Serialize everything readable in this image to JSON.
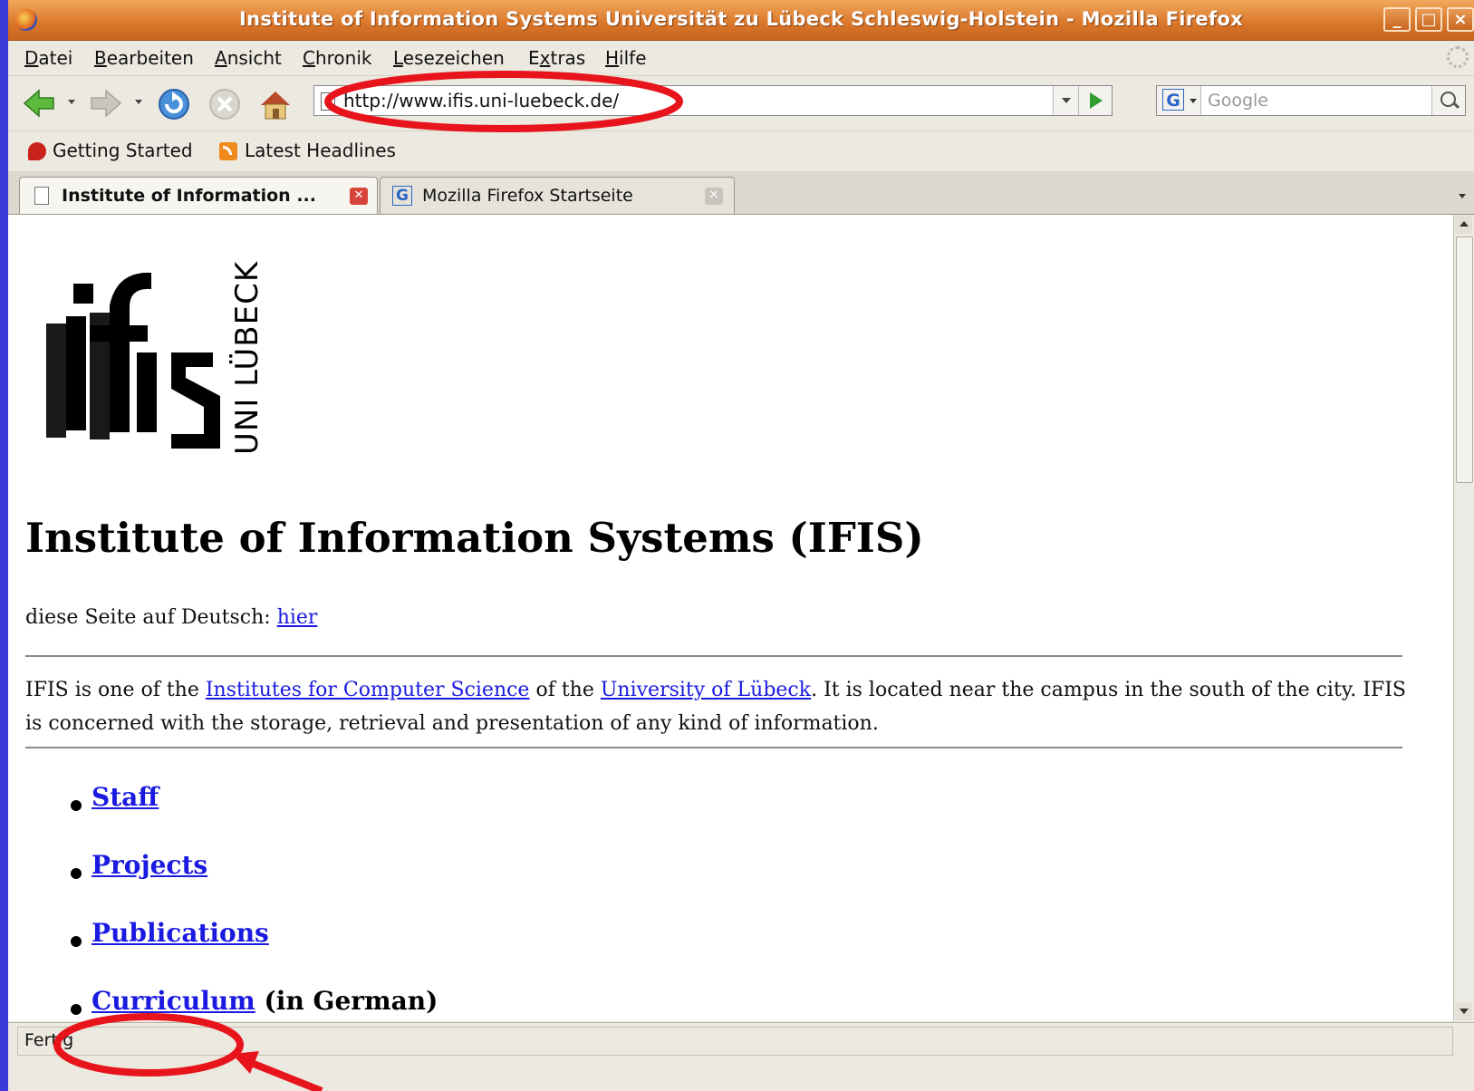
{
  "window": {
    "title": "Institute of Information Systems Universität zu Lübeck Schleswig-Holstein - Mozilla Firefox",
    "controls": {
      "minimize": "_",
      "maximize": "□",
      "close": "×"
    }
  },
  "menubar": {
    "items": [
      {
        "pre": "",
        "ul": "D",
        "post": "atei"
      },
      {
        "pre": "",
        "ul": "B",
        "post": "earbeiten"
      },
      {
        "pre": "",
        "ul": "A",
        "post": "nsicht"
      },
      {
        "pre": "",
        "ul": "C",
        "post": "hronik"
      },
      {
        "pre": "",
        "ul": "L",
        "post": "esezeichen"
      },
      {
        "pre": "E",
        "ul": "x",
        "post": "tras"
      },
      {
        "pre": "",
        "ul": "H",
        "post": "ilfe"
      }
    ]
  },
  "navbar": {
    "url": "http://www.ifis.uni-luebeck.de/",
    "search_engine_letter": "G",
    "search_placeholder": "Google"
  },
  "bookmarks": {
    "items": [
      "Getting Started",
      "Latest Headlines"
    ]
  },
  "tabs": [
    {
      "label": "Institute of Information ...",
      "active": true
    },
    {
      "label": "Mozilla Firefox Startseite",
      "active": false,
      "icon_letter": "G"
    }
  ],
  "page": {
    "logo": {
      "mark": "ifis",
      "vertical_text": "UNI LÜBECK"
    },
    "heading": "Institute of Information Systems (IFIS)",
    "german": {
      "text": "diese Seite auf Deutsch: ",
      "link": "hier"
    },
    "intro": {
      "t1": "IFIS is one of the ",
      "l1": "Institutes for Computer Science",
      "t2": " of the ",
      "l2": "University of Lübeck",
      "t3": ". It is located near the campus in the south of the city. IFIS is concerned with the storage, retrieval and presentation of any kind of information."
    },
    "links": [
      {
        "label": "Staff",
        "suffix": ""
      },
      {
        "label": "Projects",
        "suffix": ""
      },
      {
        "label": "Publications",
        "suffix": ""
      },
      {
        "label": "Curriculum",
        "suffix": " (in German)"
      }
    ]
  },
  "statusbar": {
    "text": "Fertig"
  },
  "colors": {
    "annotation": "#e8141c",
    "link": "#1a1ae0",
    "titlebar": "#d9762a",
    "desktop": "#3a3ad8"
  }
}
